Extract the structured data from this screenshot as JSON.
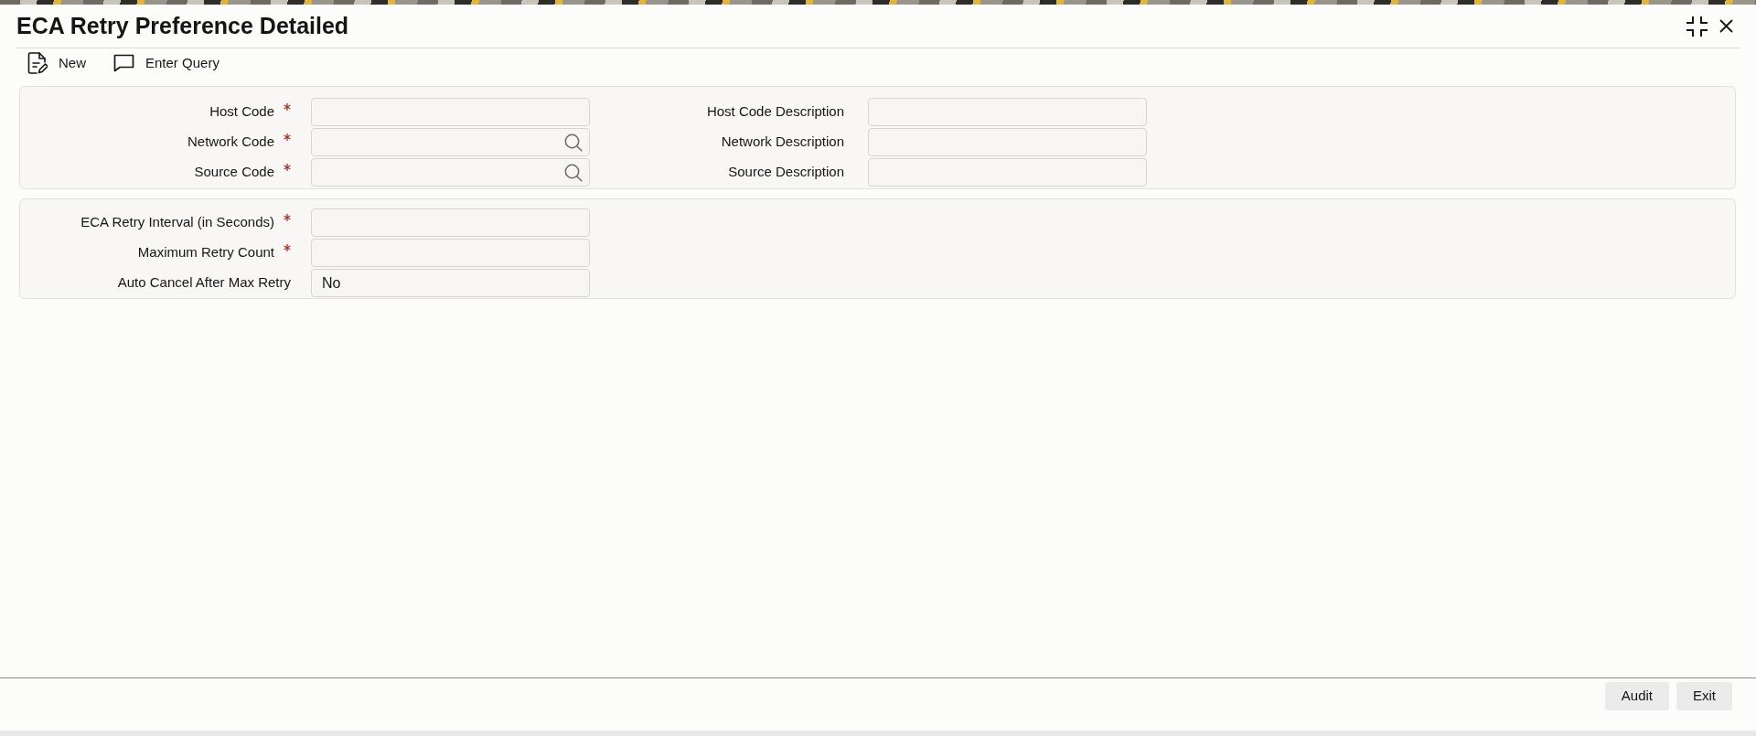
{
  "window": {
    "title": "ECA Retry Preference Detailed"
  },
  "toolbar": [
    {
      "label": "New",
      "kind": "new"
    },
    {
      "label": "Enter Query",
      "kind": "query"
    }
  ],
  "sections": [
    {
      "columns": [
        {
          "fields": [
            {
              "label": "Host Code",
              "required": true,
              "kind": "text"
            },
            {
              "label": "Network Code",
              "required": true,
              "kind": "lookup"
            },
            {
              "label": "Source Code",
              "required": true,
              "kind": "lookup"
            }
          ]
        },
        {
          "fields": [
            {
              "label": "Host Code Description",
              "required": false,
              "kind": "text"
            },
            {
              "label": "Network Description",
              "required": false,
              "kind": "text"
            },
            {
              "label": "Source Description",
              "required": false,
              "kind": "text"
            }
          ]
        }
      ]
    },
    {
      "columns": [
        {
          "fields": [
            {
              "label": "ECA Retry Interval (in Seconds)",
              "required": true,
              "kind": "text"
            },
            {
              "label": "Maximum Retry Count",
              "required": true,
              "kind": "text"
            },
            {
              "label": "Auto Cancel After Max Retry",
              "required": false,
              "kind": "text",
              "value": "No"
            }
          ]
        }
      ]
    }
  ],
  "footer": {
    "buttons": [
      "Audit",
      "Exit"
    ]
  }
}
